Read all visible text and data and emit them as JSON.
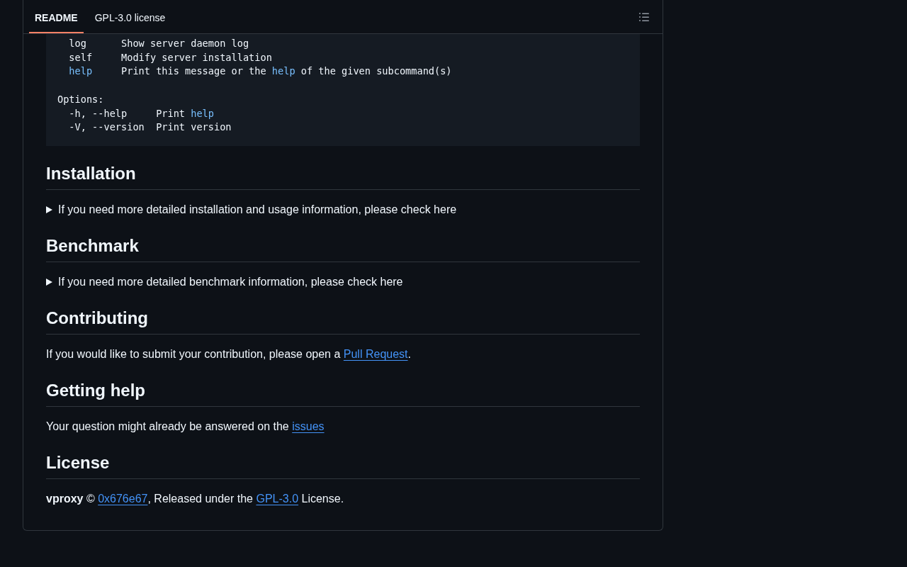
{
  "tabs": [
    {
      "label": "README",
      "selected": true
    },
    {
      "label": "GPL-3.0 license",
      "selected": false
    }
  ],
  "code_block": {
    "lines": [
      {
        "kind": "code",
        "segments": [
          {
            "kind": "plain",
            "text": "  log      Show server daemon log"
          }
        ]
      },
      {
        "kind": "code",
        "segments": [
          {
            "kind": "plain",
            "text": "  self     Modify server installation"
          }
        ]
      },
      {
        "kind": "code",
        "segments": [
          {
            "kind": "keyword",
            "text": "  help"
          },
          {
            "kind": "plain",
            "text": "     Print this message or the "
          },
          {
            "kind": "keyword",
            "text": "help"
          },
          {
            "kind": "plain",
            "text": " of the given subcommand(s)"
          }
        ]
      },
      {
        "kind": "blank"
      },
      {
        "kind": "code",
        "segments": [
          {
            "kind": "plain",
            "text": "Options:"
          }
        ]
      },
      {
        "kind": "code",
        "segments": [
          {
            "kind": "plain",
            "text": "  -h, --help     Print "
          },
          {
            "kind": "keyword",
            "text": "help"
          }
        ]
      },
      {
        "kind": "code",
        "segments": [
          {
            "kind": "plain",
            "text": "  -V, --version  Print version"
          }
        ]
      }
    ]
  },
  "sections": [
    {
      "heading": "Installation",
      "body": {
        "kind": "details",
        "expanded": false,
        "summary": "If you need more detailed installation and usage information, please check here"
      }
    },
    {
      "heading": "Benchmark",
      "body": {
        "kind": "details",
        "expanded": false,
        "summary": "If you need more detailed benchmark information, please check here"
      }
    },
    {
      "heading": "Contributing",
      "body": {
        "kind": "paragraph",
        "segments": [
          {
            "kind": "text",
            "text": "If you would like to submit your contribution, please open a "
          },
          {
            "kind": "link",
            "text": "Pull Request"
          },
          {
            "kind": "text",
            "text": "."
          }
        ]
      }
    },
    {
      "heading": "Getting help",
      "body": {
        "kind": "paragraph",
        "segments": [
          {
            "kind": "text",
            "text": "Your question might already be answered on the "
          },
          {
            "kind": "link",
            "text": "issues"
          }
        ]
      }
    },
    {
      "heading": "License",
      "body": {
        "kind": "paragraph",
        "segments": [
          {
            "kind": "text",
            "text": "**vproxy** © "
          },
          {
            "kind": "link",
            "text": "0x676e67"
          },
          {
            "kind": "text",
            "text": ", Released under the "
          },
          {
            "kind": "link",
            "text": "GPL-3.0"
          },
          {
            "kind": "text",
            "text": " License."
          }
        ]
      }
    }
  ]
}
